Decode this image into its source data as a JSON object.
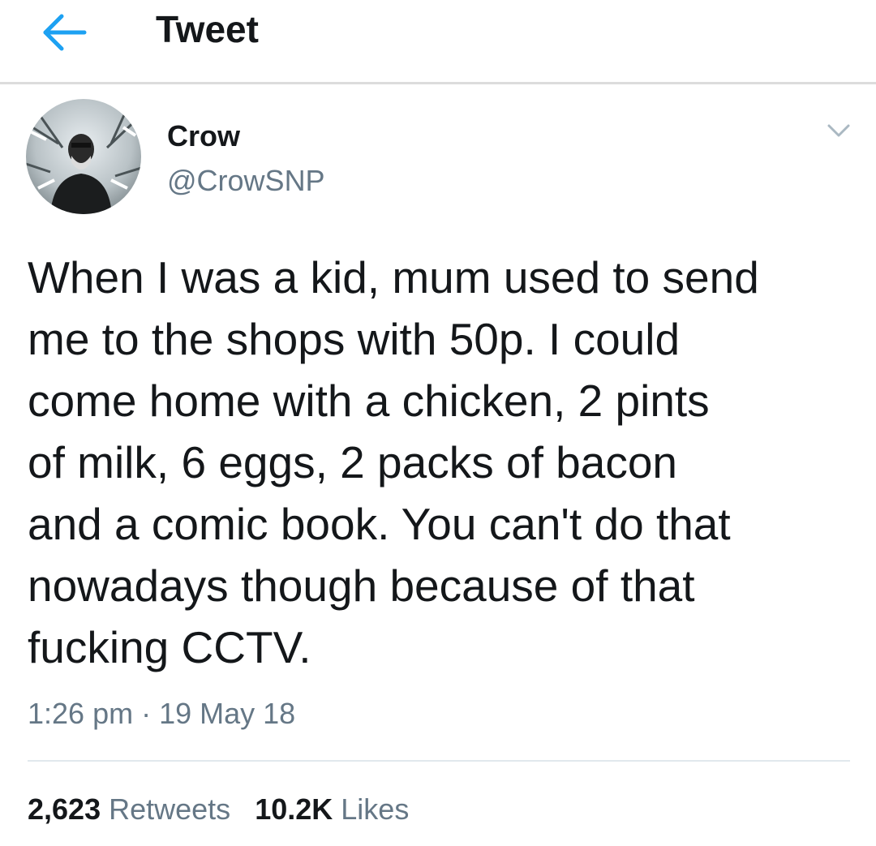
{
  "header": {
    "title": "Tweet",
    "back_icon": "arrow-left-icon",
    "accent_color": "#1da1f2"
  },
  "author": {
    "display_name": "Crow",
    "handle": "@CrowSNP",
    "menu_icon": "chevron-down-icon"
  },
  "tweet": {
    "lines": [
      "When I was a kid, mum used to send",
      "me to the shops with 50p. I could",
      "come home with a chicken, 2 pints",
      "of milk, 6 eggs, 2 packs of bacon",
      "and a comic book. You can't do that",
      "nowadays though because of that",
      "fucking CCTV."
    ],
    "timestamp": "1:26 pm · 19 May 18"
  },
  "stats": {
    "retweets_count": "2,623",
    "retweets_label": "Retweets",
    "likes_count": "10.2K",
    "likes_label": "Likes"
  }
}
